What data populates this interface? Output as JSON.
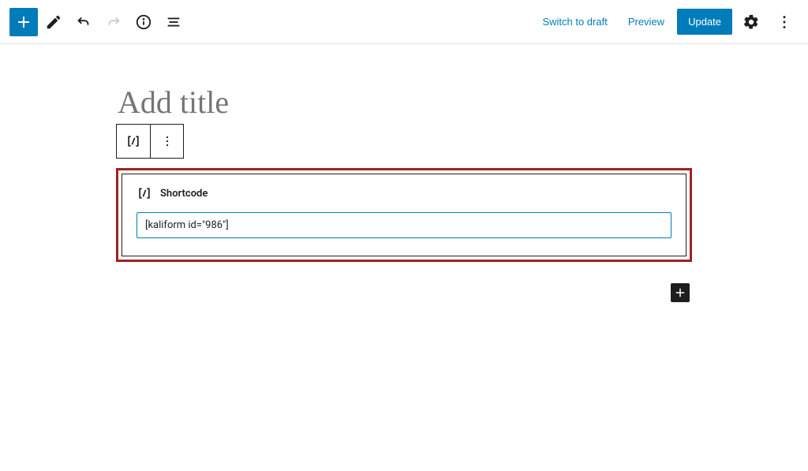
{
  "toolbar": {
    "switch_draft_label": "Switch to draft",
    "preview_label": "Preview",
    "update_label": "Update"
  },
  "editor": {
    "title_placeholder": "Add title"
  },
  "shortcode_block": {
    "label": "Shortcode",
    "value": "[kaliform id=\"986\"]"
  }
}
